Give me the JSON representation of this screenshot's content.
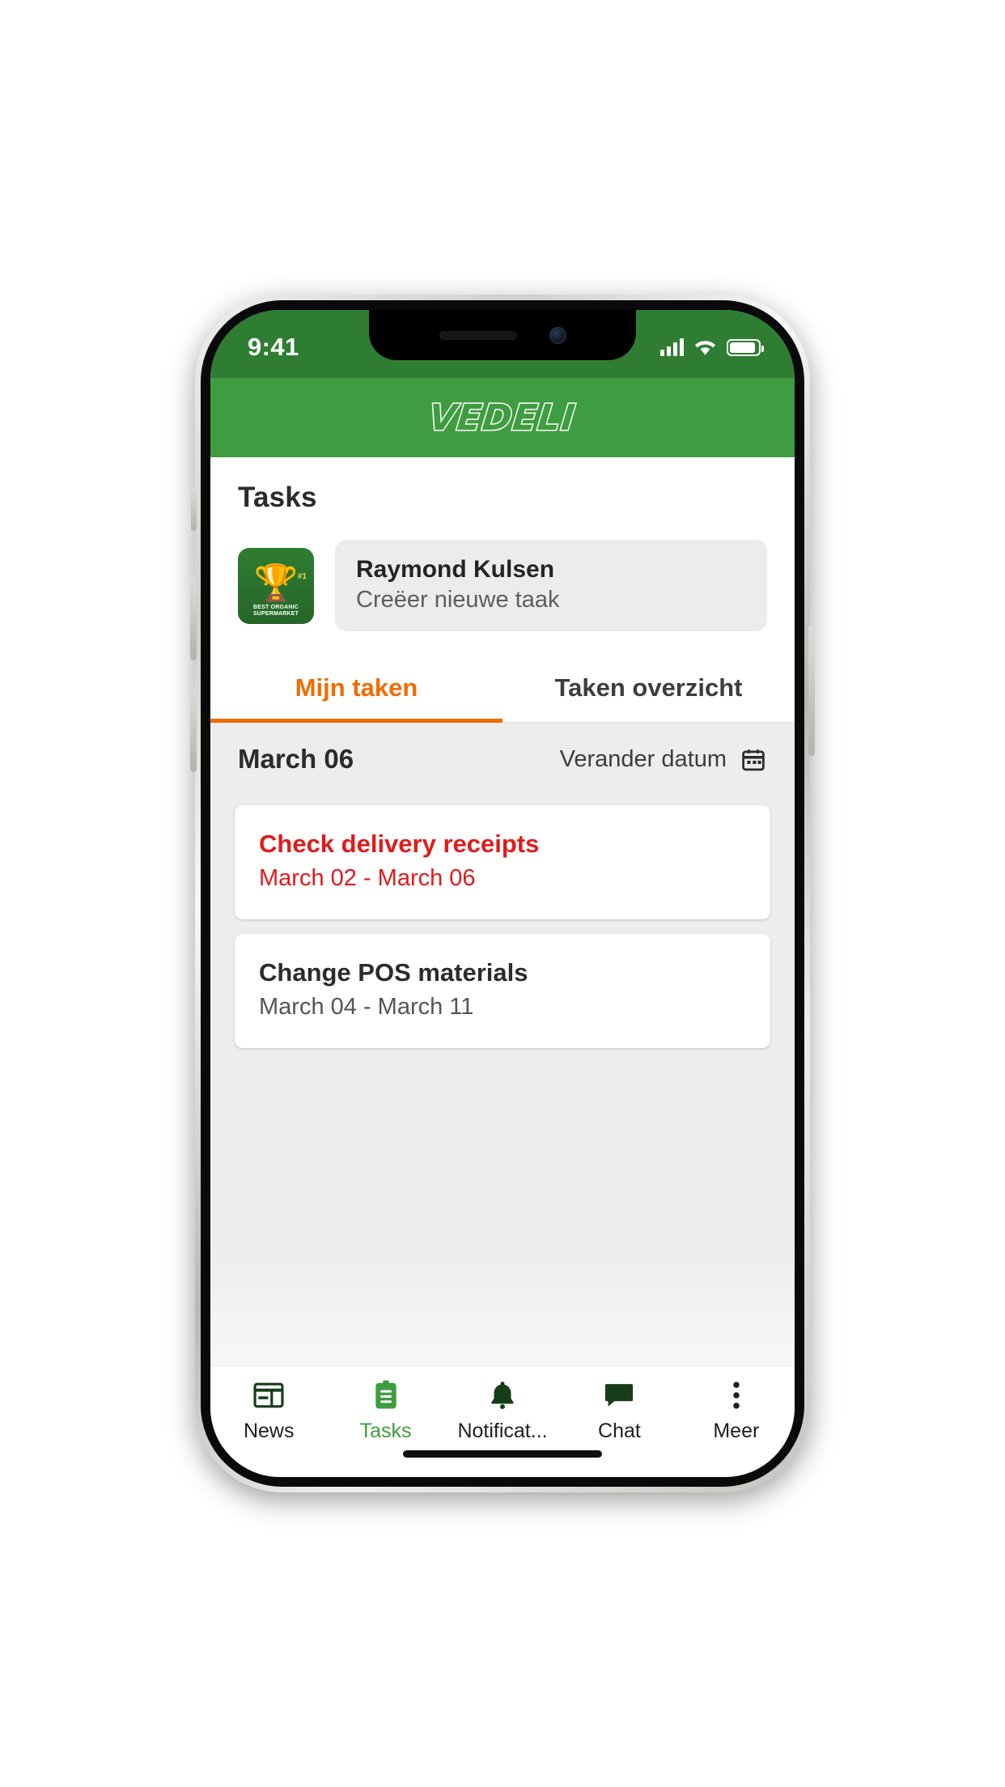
{
  "status_bar": {
    "time": "9:41",
    "signal_icon": "cellular-signal-icon",
    "wifi_icon": "wifi-icon",
    "battery_icon": "battery-full-icon"
  },
  "app_header": {
    "logo_text": "Vedeli"
  },
  "page": {
    "title": "Tasks"
  },
  "create_task": {
    "avatar_icon": "trophy-badge-avatar",
    "avatar_badge_text": "BEST ORGANIC SUPERMARKET",
    "avatar_rank": "#1",
    "user_name": "Raymond Kulsen",
    "placeholder": "Creëer nieuwe taak"
  },
  "tabs": [
    {
      "label": "Mijn taken",
      "active": true
    },
    {
      "label": "Taken overzicht",
      "active": false
    }
  ],
  "date_bar": {
    "date_label": "March 06",
    "change_label": "Verander datum",
    "calendar_icon": "calendar-icon"
  },
  "task_cards": [
    {
      "title": "Check delivery receipts",
      "date_range": "March 02 - March 06",
      "overdue": true
    },
    {
      "title": "Change POS materials",
      "date_range": "March 04 - March 11",
      "overdue": false
    }
  ],
  "tab_bar": [
    {
      "label": "News",
      "icon": "news-icon",
      "active": false
    },
    {
      "label": "Tasks",
      "icon": "clipboard-icon",
      "active": true
    },
    {
      "label": "Notificat...",
      "icon": "bell-icon",
      "active": false
    },
    {
      "label": "Chat",
      "icon": "chat-icon",
      "active": false
    },
    {
      "label": "Meer",
      "icon": "more-vertical-icon",
      "active": false
    }
  ],
  "colors": {
    "status_bar_green": "#2f7d33",
    "header_green": "#3f9c41",
    "accent_orange": "#ef6c00",
    "overdue_red": "#e01b1b",
    "page_background": "#ededed"
  }
}
